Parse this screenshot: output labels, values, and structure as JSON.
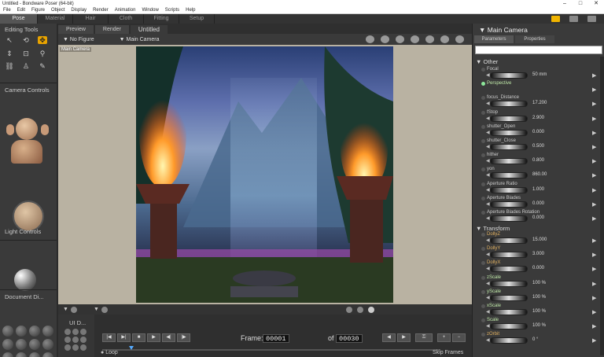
{
  "window": {
    "title": "Untitled - Bondware Poser (64-bit)"
  },
  "menu": [
    "File",
    "Edit",
    "Figure",
    "Object",
    "Display",
    "Render",
    "Animation",
    "Window",
    "Scripts",
    "Help"
  ],
  "rooms": [
    "Pose",
    "Material",
    "Hair",
    "Cloth",
    "Fitting",
    "Setup"
  ],
  "left": {
    "editing_tools": "Editing Tools",
    "camera_controls": "Camera Controls",
    "light_controls": "Light Controls",
    "document": "Document Di..."
  },
  "document": {
    "tabs": [
      "Preview",
      "Render"
    ],
    "title": "Untitled",
    "figure_select": "No Figure",
    "camera_select": "Main Camera",
    "viewport_label": "Main Camera"
  },
  "timeline": {
    "ui_dots": "UI D...",
    "frame_label": "Frame:",
    "frame_value": "00001",
    "of_label": "of",
    "frame_total": "00030",
    "loop": "Loop",
    "skip_frames": "Skip Frames"
  },
  "params": {
    "title": "Main Camera",
    "tabs": [
      "Parameters",
      "Properties"
    ],
    "section_other": "Other",
    "section_transform": "Transform",
    "other_rows": [
      {
        "name": "Focal",
        "value": "50 mm",
        "style": "normal"
      },
      {
        "name": "Perspective",
        "value": "",
        "style": "green"
      },
      {
        "name": "focus_Distance",
        "value": "17.200",
        "style": "normal"
      },
      {
        "name": "fStop",
        "value": "2.900",
        "style": "normal"
      },
      {
        "name": "shutter_Open",
        "value": "0.000",
        "style": "normal"
      },
      {
        "name": "shutter_Close",
        "value": "0.500",
        "style": "normal"
      },
      {
        "name": "hither",
        "value": "0.800",
        "style": "normal"
      },
      {
        "name": "yon",
        "value": "860.00",
        "style": "normal"
      },
      {
        "name": "Aperture Ratio",
        "value": "1.000",
        "style": "normal"
      },
      {
        "name": "Aperture Blades",
        "value": "0.000",
        "style": "normal"
      },
      {
        "name": "Aperture Blades Rotation",
        "value": "0.000",
        "style": "normal"
      }
    ],
    "transform_rows": [
      {
        "name": "DollyZ",
        "value": "15.000",
        "style": "orange"
      },
      {
        "name": "DollyY",
        "value": "3.000",
        "style": "orange"
      },
      {
        "name": "DollyX",
        "value": "0.000",
        "style": "orange"
      },
      {
        "name": "zScale",
        "value": "100 %",
        "style": "green"
      },
      {
        "name": "yScale",
        "value": "100 %",
        "style": "green"
      },
      {
        "name": "xScale",
        "value": "100 %",
        "style": "green"
      },
      {
        "name": "Scale",
        "value": "100 %",
        "style": "green"
      },
      {
        "name": "zOrbit",
        "value": "0 °",
        "style": "orange"
      }
    ]
  },
  "colors": {
    "accent": "#e8a300",
    "bg": "#3a3a3a",
    "viewport": "#b9b2a2"
  }
}
